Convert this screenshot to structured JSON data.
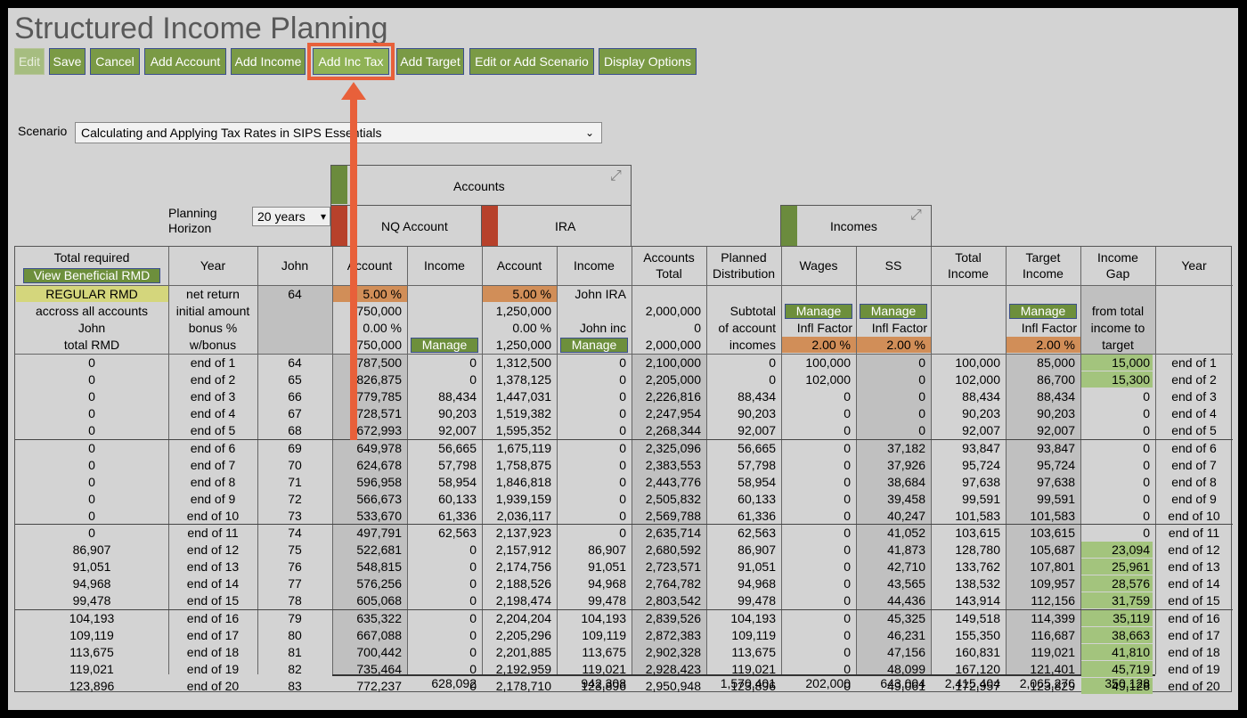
{
  "page_title": "Structured Income Planning",
  "toolbar": {
    "edit": "Edit",
    "save": "Save",
    "cancel": "Cancel",
    "add_account": "Add Account",
    "add_income": "Add Income",
    "add_inc_tax": "Add Inc Tax",
    "add_target": "Add Target",
    "edit_scenario": "Edit or Add Scenario",
    "display_options": "Display Options"
  },
  "scenario": {
    "label": "Scenario",
    "value": "Calculating and Applying Tax Rates in SIPS Essentials"
  },
  "planning_horizon": {
    "label_1": "Planning",
    "label_2": "Horizon",
    "value": "20 years"
  },
  "groups": {
    "accounts": "Accounts",
    "incomes": "Incomes",
    "nq_account": "NQ Account",
    "ira": "IRA"
  },
  "headers": {
    "total_required": "Total required",
    "view_rmd": "View Beneficial RMD",
    "year": "Year",
    "john": "John",
    "account": "Account",
    "income": "Income",
    "accounts_total_1": "Accounts",
    "accounts_total_2": "Total",
    "planned_1": "Planned",
    "planned_2": "Distribution",
    "wages": "Wages",
    "ss": "SS",
    "total_income_1": "Total",
    "total_income_2": "Income",
    "target_income_1": "Target",
    "target_income_2": "Income",
    "income_gap_1": "Income",
    "income_gap_2": "Gap",
    "year_right": "Year"
  },
  "subheader": {
    "regular_rmd": "REGULAR RMD",
    "across": "accross all accounts",
    "john_total_1": "John",
    "john_total_2": "total RMD",
    "net_return": "net return",
    "initial_amount": "initial amount",
    "bonus": "bonus %",
    "wbonus": "w/bonus",
    "age": "64",
    "nq_rate": "5.00 %",
    "nq_initial": "750,000",
    "nq_bonus": "0.00 %",
    "nq_wbonus": "750,000",
    "ira_rate": "5.00 %",
    "ira_initial": "1,250,000",
    "ira_bonus": "0.00 %",
    "ira_wbonus": "1,250,000",
    "john_ira": "John IRA",
    "john_inc": "John inc",
    "acct_total_initial": "2,000,000",
    "acct_total_bonus": "0",
    "acct_total_wbonus": "2,000,000",
    "subtotal": "Subtotal",
    "of_account": "of account",
    "incomes_word": "incomes",
    "manage": "Manage",
    "infl_factor": "Infl Factor",
    "wages_infl": "2.00 %",
    "ss_infl": "2.00 %",
    "target_infl": "2.00 %",
    "from_total": "from total",
    "income_to": "income to",
    "target_word": "target"
  },
  "rows": [
    [
      "0",
      "end of 1",
      "64",
      "787,500",
      "0",
      "1,312,500",
      "0",
      "2,100,000",
      "0",
      "100,000",
      "0",
      "100,000",
      "85,000",
      "15,000",
      "end of 1"
    ],
    [
      "0",
      "end of 2",
      "65",
      "826,875",
      "0",
      "1,378,125",
      "0",
      "2,205,000",
      "0",
      "102,000",
      "0",
      "102,000",
      "86,700",
      "15,300",
      "end of 2"
    ],
    [
      "0",
      "end of 3",
      "66",
      "779,785",
      "88,434",
      "1,447,031",
      "0",
      "2,226,816",
      "88,434",
      "0",
      "0",
      "88,434",
      "88,434",
      "0",
      "end of 3"
    ],
    [
      "0",
      "end of 4",
      "67",
      "728,571",
      "90,203",
      "1,519,382",
      "0",
      "2,247,954",
      "90,203",
      "0",
      "0",
      "90,203",
      "90,203",
      "0",
      "end of 4"
    ],
    [
      "0",
      "end of 5",
      "68",
      "672,993",
      "92,007",
      "1,595,352",
      "0",
      "2,268,344",
      "92,007",
      "0",
      "0",
      "92,007",
      "92,007",
      "0",
      "end of 5"
    ],
    [
      "0",
      "end of 6",
      "69",
      "649,978",
      "56,665",
      "1,675,119",
      "0",
      "2,325,096",
      "56,665",
      "0",
      "37,182",
      "93,847",
      "93,847",
      "0",
      "end of 6"
    ],
    [
      "0",
      "end of 7",
      "70",
      "624,678",
      "57,798",
      "1,758,875",
      "0",
      "2,383,553",
      "57,798",
      "0",
      "37,926",
      "95,724",
      "95,724",
      "0",
      "end of 7"
    ],
    [
      "0",
      "end of 8",
      "71",
      "596,958",
      "58,954",
      "1,846,818",
      "0",
      "2,443,776",
      "58,954",
      "0",
      "38,684",
      "97,638",
      "97,638",
      "0",
      "end of 8"
    ],
    [
      "0",
      "end of 9",
      "72",
      "566,673",
      "60,133",
      "1,939,159",
      "0",
      "2,505,832",
      "60,133",
      "0",
      "39,458",
      "99,591",
      "99,591",
      "0",
      "end of 9"
    ],
    [
      "0",
      "end of 10",
      "73",
      "533,670",
      "61,336",
      "2,036,117",
      "0",
      "2,569,788",
      "61,336",
      "0",
      "40,247",
      "101,583",
      "101,583",
      "0",
      "end of 10"
    ],
    [
      "0",
      "end of 11",
      "74",
      "497,791",
      "62,563",
      "2,137,923",
      "0",
      "2,635,714",
      "62,563",
      "0",
      "41,052",
      "103,615",
      "103,615",
      "0",
      "end of 11"
    ],
    [
      "86,907",
      "end of 12",
      "75",
      "522,681",
      "0",
      "2,157,912",
      "86,907",
      "2,680,592",
      "86,907",
      "0",
      "41,873",
      "128,780",
      "105,687",
      "23,094",
      "end of 12"
    ],
    [
      "91,051",
      "end of 13",
      "76",
      "548,815",
      "0",
      "2,174,756",
      "91,051",
      "2,723,571",
      "91,051",
      "0",
      "42,710",
      "133,762",
      "107,801",
      "25,961",
      "end of 13"
    ],
    [
      "94,968",
      "end of 14",
      "77",
      "576,256",
      "0",
      "2,188,526",
      "94,968",
      "2,764,782",
      "94,968",
      "0",
      "43,565",
      "138,532",
      "109,957",
      "28,576",
      "end of 14"
    ],
    [
      "99,478",
      "end of 15",
      "78",
      "605,068",
      "0",
      "2,198,474",
      "99,478",
      "2,803,542",
      "99,478",
      "0",
      "44,436",
      "143,914",
      "112,156",
      "31,759",
      "end of 15"
    ],
    [
      "104,193",
      "end of 16",
      "79",
      "635,322",
      "0",
      "2,204,204",
      "104,193",
      "2,839,526",
      "104,193",
      "0",
      "45,325",
      "149,518",
      "114,399",
      "35,119",
      "end of 16"
    ],
    [
      "109,119",
      "end of 17",
      "80",
      "667,088",
      "0",
      "2,205,296",
      "109,119",
      "2,872,383",
      "109,119",
      "0",
      "46,231",
      "155,350",
      "116,687",
      "38,663",
      "end of 17"
    ],
    [
      "113,675",
      "end of 18",
      "81",
      "700,442",
      "0",
      "2,201,885",
      "113,675",
      "2,902,328",
      "113,675",
      "0",
      "47,156",
      "160,831",
      "119,021",
      "41,810",
      "end of 18"
    ],
    [
      "119,021",
      "end of 19",
      "82",
      "735,464",
      "0",
      "2,192,959",
      "119,021",
      "2,928,423",
      "119,021",
      "0",
      "48,099",
      "167,120",
      "121,401",
      "45,719",
      "end of 19"
    ],
    [
      "123,896",
      "end of 20",
      "83",
      "772,237",
      "0",
      "2,178,710",
      "123,896",
      "2,950,948",
      "123,896",
      "0",
      "49,061",
      "172,957",
      "123,829",
      "49,128",
      "end of 20"
    ]
  ],
  "totals": {
    "nq_income": "628,092",
    "ira_income": "942,308",
    "planned": "1,570,401",
    "wages": "202,000",
    "ss": "643,004",
    "total_income": "2,415,404",
    "target": "2,065,276",
    "gap": "350,128"
  },
  "colors": {
    "accent_green": "#7a9a45",
    "highlight": "#e8603a",
    "gap_green": "#a3c47d",
    "rate_orange": "#d18e58"
  }
}
